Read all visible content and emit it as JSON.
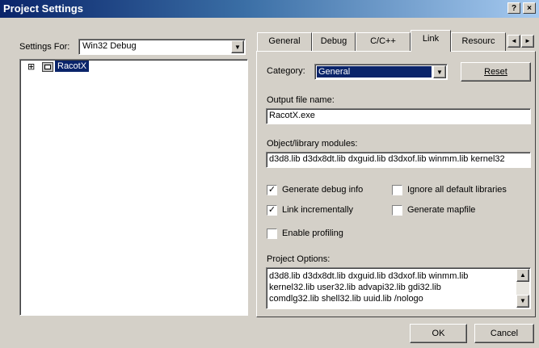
{
  "window": {
    "title": "Project Settings",
    "help_button": "?",
    "close_button": "×"
  },
  "left": {
    "settings_for_label": "Settings For:",
    "settings_for_value": "Win32 Debug",
    "tree": {
      "expander": "⊞",
      "item_label": "RacotX"
    }
  },
  "tabs": [
    {
      "label": "General",
      "active": false
    },
    {
      "label": "Debug",
      "active": false
    },
    {
      "label": "C/C++",
      "active": false
    },
    {
      "label": "Link",
      "active": true
    },
    {
      "label": "Resourc",
      "active": false
    }
  ],
  "tab_scroll": {
    "left": "◄",
    "right": "►"
  },
  "link_panel": {
    "category_label": "Category:",
    "category_value": "General",
    "reset_button": "Reset",
    "output_file_label": "Output file name:",
    "output_file_value": "RacotX.exe",
    "modules_label": "Object/library modules:",
    "modules_value": "d3d8.lib d3dx8dt.lib dxguid.lib d3dxof.lib winmm.lib kernel32",
    "checkboxes": {
      "generate_debug_info": {
        "label": "Generate debug info",
        "checked": true,
        "mark": "✓"
      },
      "ignore_default_libraries": {
        "label": "Ignore all default libraries",
        "checked": false,
        "mark": ""
      },
      "link_incrementally": {
        "label": "Link incrementally",
        "checked": true,
        "mark": "✓"
      },
      "generate_mapfile": {
        "label": "Generate mapfile",
        "checked": false,
        "mark": ""
      },
      "enable_profiling": {
        "label": "Enable profiling",
        "checked": false,
        "mark": ""
      }
    },
    "project_options_label": "Project Options:",
    "project_options_lines": [
      "d3d8.lib d3dx8dt.lib dxguid.lib d3dxof.lib winmm.lib",
      "kernel32.lib user32.lib advapi32.lib gdi32.lib",
      "comdlg32.lib shell32.lib uuid.lib /nologo"
    ],
    "scroll_up": "▲",
    "scroll_down": "▼"
  },
  "footer": {
    "ok_button": "OK",
    "cancel_button": "Cancel"
  }
}
